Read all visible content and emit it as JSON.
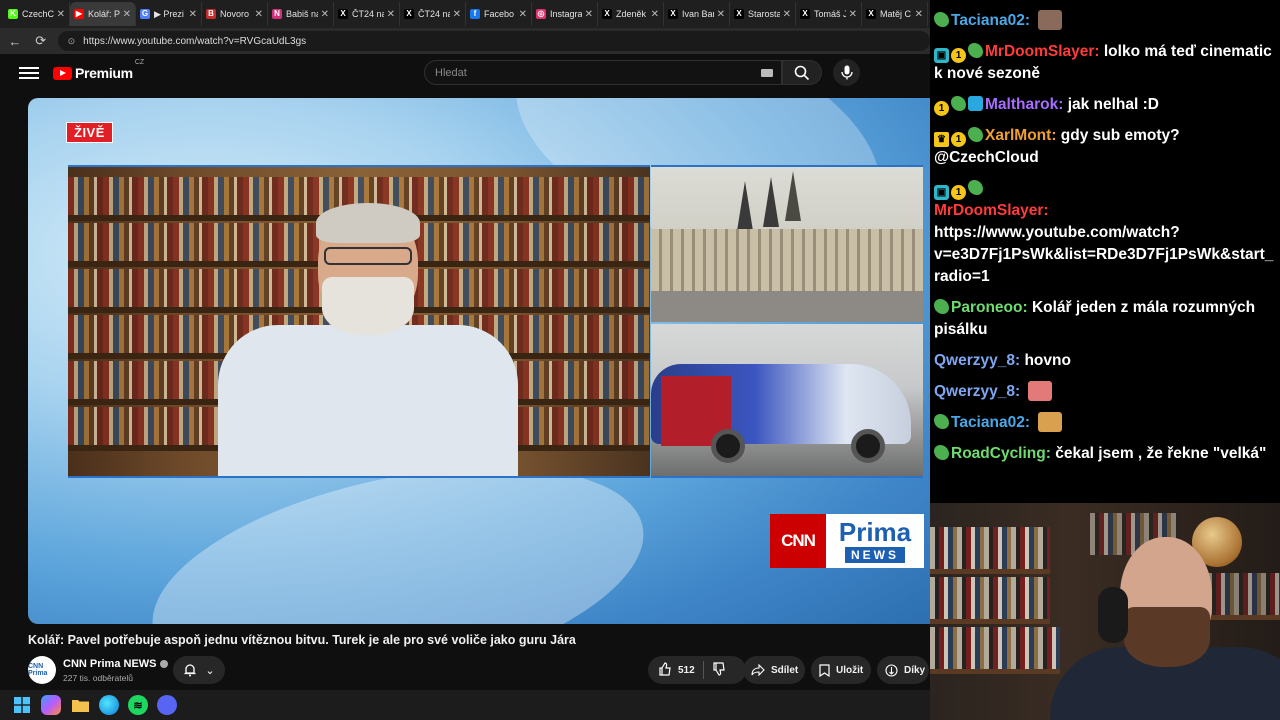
{
  "browser": {
    "tabs": [
      {
        "label": "CzechC",
        "fav": "K",
        "fav_color": "#53fc18"
      },
      {
        "label": "Kolář: P",
        "fav": "▶",
        "fav_color": "#ff0000",
        "active": true
      },
      {
        "label": "▶ Prezi",
        "fav": "G",
        "fav_color": "#4f7fff"
      },
      {
        "label": "Novoro",
        "fav": "B",
        "fav_color": "#c62b2b"
      },
      {
        "label": "Babiš na",
        "fav": "N",
        "fav_color": "#d0317a"
      },
      {
        "label": "ČT24 na",
        "fav": "X",
        "fav_color": "#000000"
      },
      {
        "label": "ČT24 na",
        "fav": "X",
        "fav_color": "#000000"
      },
      {
        "label": "Facebo",
        "fav": "f",
        "fav_color": "#1877f2"
      },
      {
        "label": "Instagra",
        "fav": "◎",
        "fav_color": "#e1306c"
      },
      {
        "label": "Zdeněk",
        "fav": "X",
        "fav_color": "#000000"
      },
      {
        "label": "Ivan Bar",
        "fav": "X",
        "fav_color": "#000000"
      },
      {
        "label": "Starosta",
        "fav": "X",
        "fav_color": "#000000"
      },
      {
        "label": "Tomáš J",
        "fav": "X",
        "fav_color": "#000000"
      },
      {
        "label": "Matěj C",
        "fav": "X",
        "fav_color": "#000000"
      }
    ],
    "url": "https://www.youtube.com/watch?v=RVGcaUdL3gs"
  },
  "youtube": {
    "logo_text": "Premium",
    "logo_country": "CZ",
    "search_placeholder": "Hledat"
  },
  "video": {
    "live_label": "ŽIVĚ",
    "brand_cnn": "CNN",
    "brand_prima": "Prima",
    "brand_news": "NEWS",
    "title": "Kolář: Pavel potřebuje aspoň jednu vítěznou bitvu. Turek je ale pro své voliče jako guru Jára",
    "channel_name": "CNN Prima NEWS",
    "channel_subs": "227 tis. odběratelů",
    "avatar_text": "CNN Prima",
    "likes": "512",
    "share_label": "Sdílet",
    "save_label": "Uložit",
    "thanks_label": "Díky"
  },
  "chat": {
    "messages": [
      {
        "badges": [
          "bug"
        ],
        "user": "Taciana02",
        "color": "#4aa8e8",
        "text": "",
        "emote": "#8a6a5a"
      },
      {
        "badges": [
          "robot",
          "coin",
          "bug"
        ],
        "user": "MrDoomSlayer",
        "color": "#ff3b3b",
        "text": "lolko má teď cinematic k nové sezoně"
      },
      {
        "badges": [
          "coin",
          "bug",
          "cube"
        ],
        "user": "Maltharok",
        "color": "#a86cff",
        "text": "jak nelhal :D"
      },
      {
        "badges": [
          "crown",
          "coin",
          "bug"
        ],
        "user": "XarlMont",
        "color": "#f0a030",
        "text": "gdy sub emoty? @CzechCloud"
      },
      {
        "badges": [
          "robot",
          "coin",
          "bug"
        ],
        "user": "MrDoomSlayer",
        "color": "#ff3b3b",
        "text": "https://www.youtube.com/watch?v=e3D7Fj1PsWk&list=RDe3D7Fj1PsWk&start_radio=1",
        "break_user": true
      },
      {
        "badges": [
          "bug"
        ],
        "user": "Paroneoo",
        "color": "#6fdc6f",
        "text": "Kolář jeden z mála rozumných pisálku"
      },
      {
        "badges": [],
        "user": "Qwerzyy_8",
        "color": "#7ea7f0",
        "text": "hovno"
      },
      {
        "badges": [],
        "user": "Qwerzyy_8",
        "color": "#7ea7f0",
        "text": "",
        "emote": "#e27a7a"
      },
      {
        "badges": [
          "bug"
        ],
        "user": "Taciana02",
        "color": "#4aa8e8",
        "text": "",
        "emote": "#d9a050"
      },
      {
        "badges": [
          "bug"
        ],
        "user": "RoadCycling",
        "color": "#6fdc6f",
        "text": "čekal jsem , že řekne \"velká\""
      }
    ]
  },
  "taskbar": {
    "apps": [
      "windows-start",
      "copilot",
      "file-explorer",
      "edge",
      "spotify",
      "discord"
    ]
  }
}
